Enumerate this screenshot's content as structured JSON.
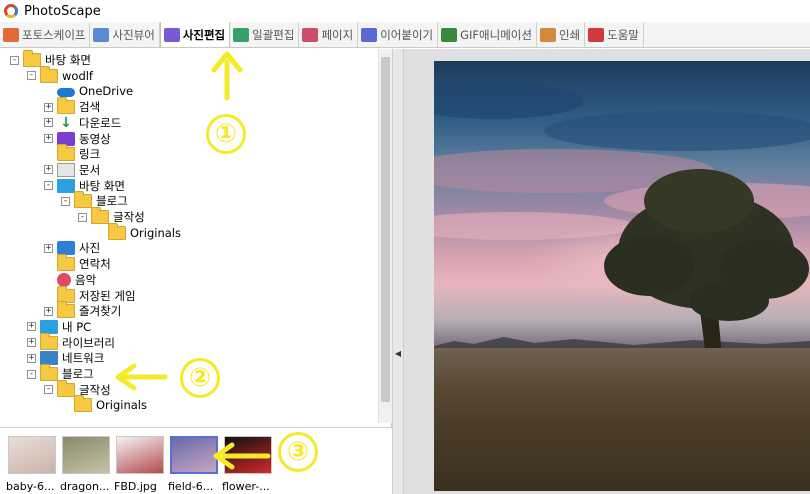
{
  "window": {
    "title": "PhotoScape"
  },
  "tabs": [
    {
      "label": "포토스케이프",
      "color": "#e06a3a"
    },
    {
      "label": "사진뷰어",
      "color": "#5a8ad0"
    },
    {
      "label": "사진편집",
      "color": "#7a5ad0",
      "active": true
    },
    {
      "label": "일괄편집",
      "color": "#3aa06a"
    },
    {
      "label": "페이지",
      "color": "#d04a6a"
    },
    {
      "label": "이어붙이기",
      "color": "#5a6ad0"
    },
    {
      "label": "GIF애니메이션",
      "color": "#3a8a3a"
    },
    {
      "label": "인쇄",
      "color": "#d08a3a"
    },
    {
      "label": "도움말",
      "color": "#d03a3a"
    }
  ],
  "tree": [
    {
      "label": "바탕 화면",
      "icon": "folder-icon",
      "depth": 0,
      "expander": "-"
    },
    {
      "label": "wodlf",
      "icon": "folder-icon",
      "depth": 1,
      "expander": "-"
    },
    {
      "label": "OneDrive",
      "icon": "cloud-icon",
      "depth": 2,
      "expander": ""
    },
    {
      "label": "검색",
      "icon": "folder-icon",
      "depth": 2,
      "expander": "+"
    },
    {
      "label": "다운로드",
      "icon": "download-icon",
      "depth": 2,
      "expander": "+"
    },
    {
      "label": "동영상",
      "icon": "video-icon",
      "depth": 2,
      "expander": "+"
    },
    {
      "label": "링크",
      "icon": "folder-icon",
      "depth": 2,
      "expander": ""
    },
    {
      "label": "문서",
      "icon": "document-icon",
      "depth": 2,
      "expander": "+"
    },
    {
      "label": "바탕 화면",
      "icon": "desktop-icon",
      "depth": 2,
      "expander": "-"
    },
    {
      "label": "블로그",
      "icon": "folder-icon",
      "depth": 3,
      "expander": "-"
    },
    {
      "label": "글작성",
      "icon": "folder-icon",
      "depth": 4,
      "expander": "-"
    },
    {
      "label": "Originals",
      "icon": "folder-icon",
      "depth": 5,
      "expander": ""
    },
    {
      "label": "사진",
      "icon": "pictures-icon",
      "depth": 2,
      "expander": "+"
    },
    {
      "label": "연락처",
      "icon": "folder-icon",
      "depth": 2,
      "expander": ""
    },
    {
      "label": "음악",
      "icon": "music-icon",
      "depth": 2,
      "expander": ""
    },
    {
      "label": "저장된 게임",
      "icon": "folder-icon",
      "depth": 2,
      "expander": ""
    },
    {
      "label": "즐겨찾기",
      "icon": "folder-icon",
      "depth": 2,
      "expander": "+"
    },
    {
      "label": "내 PC",
      "icon": "monitor-icon",
      "depth": 1,
      "expander": "+"
    },
    {
      "label": "라이브러리",
      "icon": "folder-icon",
      "depth": 1,
      "expander": "+"
    },
    {
      "label": "네트워크",
      "icon": "network-icon",
      "depth": 1,
      "expander": "+"
    },
    {
      "label": "블로그",
      "icon": "folder-icon",
      "depth": 1,
      "expander": "-"
    },
    {
      "label": "글작성",
      "icon": "folder-icon",
      "depth": 2,
      "expander": "-"
    },
    {
      "label": "Originals",
      "icon": "folder-icon",
      "depth": 3,
      "expander": ""
    }
  ],
  "thumbnails": [
    {
      "label": "baby-6...",
      "colors": [
        "#e8ddd6",
        "#c9b4a8"
      ]
    },
    {
      "label": "dragon...",
      "colors": [
        "#8a8a6a",
        "#c6c2a8"
      ]
    },
    {
      "label": "FBD.jpg",
      "colors": [
        "#f4f4f4",
        "#b44a4a"
      ]
    },
    {
      "label": "field-6...",
      "colors": [
        "#6a6aa8",
        "#c6a6c6"
      ],
      "selected": true
    },
    {
      "label": "flower-...",
      "colors": [
        "#101010",
        "#d02a2a"
      ]
    }
  ],
  "annotations": {
    "arrow_color": "#f5ea2a",
    "marker_1": "①",
    "marker_2": "②",
    "marker_3": "③"
  }
}
